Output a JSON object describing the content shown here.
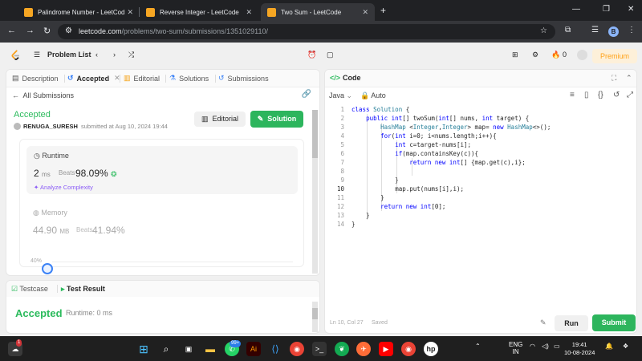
{
  "browser": {
    "tabs": [
      {
        "title": "Palindrome Number - LeetCod"
      },
      {
        "title": "Reverse Integer - LeetCode"
      },
      {
        "title": "Two Sum - LeetCode"
      }
    ],
    "url_host": "leetcode.com",
    "url_path": "/problems/two-sum/submissions/1351029110/",
    "profile_initial": "B"
  },
  "nav": {
    "problem_list": "Problem List",
    "streak": "0",
    "premium": "Premium"
  },
  "left_tabs": [
    {
      "label": "Description"
    },
    {
      "label": "Accepted"
    },
    {
      "label": "Editorial"
    },
    {
      "label": "Solutions"
    },
    {
      "label": "Submissions"
    }
  ],
  "submission": {
    "back_label": "All Submissions",
    "status": "Accepted",
    "user": "RENUGA_SURESH",
    "submitted_text": "submitted at Aug 10, 2024 19:44",
    "editorial_btn": "Editorial",
    "solution_btn": "Solution",
    "runtime_title": "Runtime",
    "runtime_value": "2",
    "runtime_unit": "ms",
    "beats_label": "Beats",
    "runtime_beats": "98.09%",
    "analyze": "Analyze Complexity",
    "memory_title": "Memory",
    "memory_value": "44.90",
    "memory_unit": "MB",
    "memory_beats": "41.94%",
    "chart_tick": "40%"
  },
  "testcase": {
    "tab1": "Testcase",
    "tab2": "Test Result",
    "status": "Accepted",
    "runtime": "Runtime: 0 ms"
  },
  "code": {
    "title": "Code",
    "language": "Java",
    "mode": "Auto",
    "lines": [
      "class Solution {",
      "    public int[] twoSum(int[] nums, int target) {",
      "        HashMap <Integer,Integer> map= new HashMap<>();",
      "        for(int i=0; i<nums.length;i++){",
      "            int c=target-nums[i];",
      "            if(map.containsKey(c)){",
      "                return new int[] {map.get(c),i};",
      "            ",
      "            }",
      "            map.put(nums[i],i);",
      "        }",
      "        return new int[0];",
      "    }",
      "}"
    ],
    "cursor": "Ln 10, Col 27",
    "saved": "Saved",
    "run_btn": "Run",
    "submit_btn": "Submit"
  },
  "taskbar": {
    "notification_count": "1",
    "whatsapp_badge": "99+",
    "lang_top": "ENG",
    "lang_bottom": "IN",
    "time": "19:41",
    "date": "10-08-2024"
  }
}
